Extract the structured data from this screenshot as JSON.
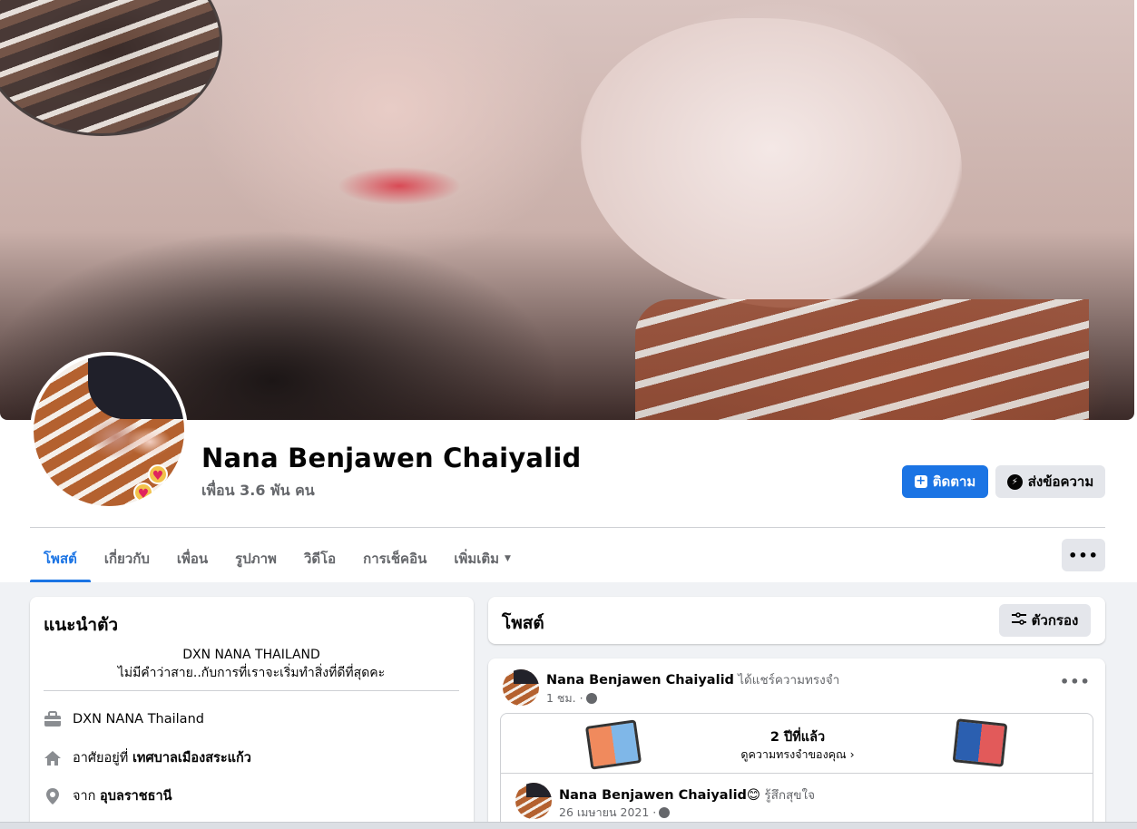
{
  "profile": {
    "name": "Nana Benjawen Chaiyalid",
    "friends": "เพื่อน 3.6 พัน คน"
  },
  "actions": {
    "follow_label": "ติดตาม",
    "message_label": "ส่งข้อความ",
    "more_label": "•••"
  },
  "tabs": [
    {
      "label": "โพสต์",
      "active": true
    },
    {
      "label": "เกี่ยวกับ"
    },
    {
      "label": "เพื่อน"
    },
    {
      "label": "รูปภาพ"
    },
    {
      "label": "วิดีโอ"
    },
    {
      "label": "การเช็คอิน"
    },
    {
      "label": "เพิ่มเติม"
    }
  ],
  "intro": {
    "title": "แนะนำตัว",
    "bio_line1": "DXN NANA THAILAND",
    "bio_line2": "ไม่มีคำว่าสาย..กับการที่เราจะเริ่มทำสิ่งที่ดีที่สุดคะ",
    "work": "DXN NANA Thailand",
    "lives_prefix": "อาศัยอยู่ที่ ",
    "lives_place": "เทศบาลเมืองสระแก้ว",
    "from_prefix": "จาก ",
    "from_place": "อุบลราชธานี"
  },
  "posts": {
    "title": "โพสต์",
    "filter_label": "ตัวกรอง"
  },
  "post": {
    "author": "Nana Benjawen Chaiyalid",
    "action": " ได้แชร์ความทรงจำ",
    "time": "1 ชม. ·",
    "memory_years": "2 ปีที่แล้ว",
    "memory_link": "ดูความทรงจำของคุณ",
    "shared_author": "Nana Benjawen Chaiyalid",
    "shared_feeling": " รู้สึกสุขใจ",
    "shared_date": "26 เมษายน 2021 ·"
  },
  "colors": {
    "accent": "#1b74e4",
    "background": "#f0f2f5",
    "secondary_button": "#e4e6eb"
  }
}
